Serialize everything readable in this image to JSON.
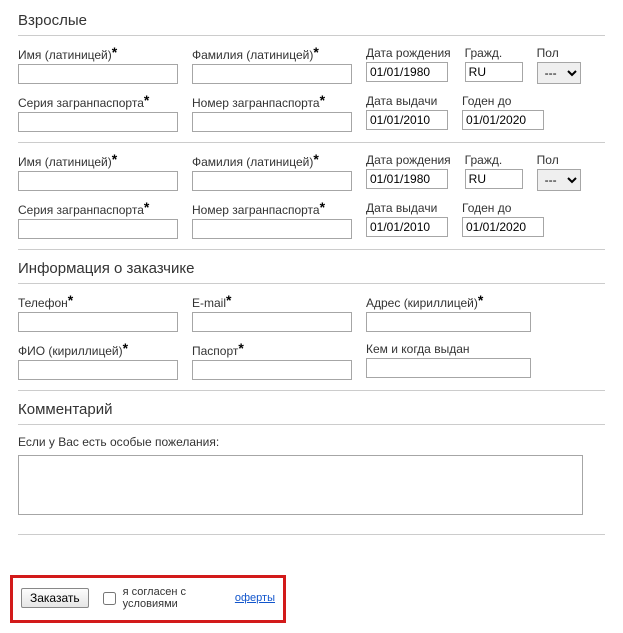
{
  "adults": {
    "title": "Взрослые",
    "persons": [
      {
        "first_name_label": "Имя (латиницей)",
        "last_name_label": "Фамилия (латиницей)",
        "dob_label": "Дата рождения",
        "dob_value": "01/01/1980",
        "nat_label": "Гражд.",
        "nat_value": "RU",
        "gender_label": "Пол",
        "gender_value": "---",
        "pass_series_label": "Серия загранпаспорта",
        "pass_number_label": "Номер загранпаспорта",
        "issue_date_label": "Дата выдачи",
        "issue_date_value": "01/01/2010",
        "valid_until_label": "Годен до",
        "valid_until_value": "01/01/2020"
      },
      {
        "first_name_label": "Имя (латиницей)",
        "last_name_label": "Фамилия (латиницей)",
        "dob_label": "Дата рождения",
        "dob_value": "01/01/1980",
        "nat_label": "Гражд.",
        "nat_value": "RU",
        "gender_label": "Пол",
        "gender_value": "---",
        "pass_series_label": "Серия загранпаспорта",
        "pass_number_label": "Номер загранпаспорта",
        "issue_date_label": "Дата выдачи",
        "issue_date_value": "01/01/2010",
        "valid_until_label": "Годен до",
        "valid_until_value": "01/01/2020"
      }
    ]
  },
  "customer": {
    "title": "Информация о заказчике",
    "phone_label": "Телефон",
    "email_label": "E-mail",
    "address_label": "Адрес (кириллицей)",
    "fio_label": "ФИО (кириллицей)",
    "passport_label": "Паспорт",
    "issued_by_label": "Кем и когда выдан"
  },
  "comment": {
    "title": "Комментарий",
    "hint": "Если у Вас есть особые пожелания:"
  },
  "footer": {
    "order_label": "Заказать",
    "agree_text": "я согласен с условиями ",
    "offer_link": "оферты"
  }
}
